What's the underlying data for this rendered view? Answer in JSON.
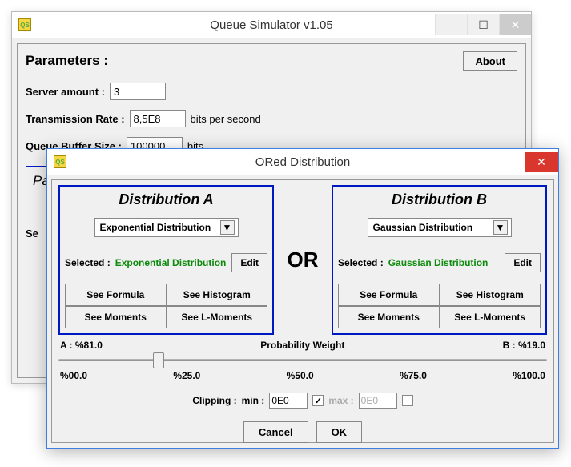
{
  "main": {
    "title": "Queue Simulator v1.05",
    "icon_text": "QS",
    "params_label": "Parameters :",
    "about_label": "About",
    "server_amount_label": "Server amount :",
    "server_amount_value": "3",
    "trans_rate_label": "Transmission Rate :",
    "trans_rate_value": "8,5E8",
    "trans_rate_unit": "bits per second",
    "queue_buf_label": "Queue Buffer Size :",
    "queue_buf_value": "100000",
    "queue_buf_unit": "bits",
    "partial_left": "Pa",
    "select_label": "Se"
  },
  "dialog": {
    "title": "ORed Distribution",
    "icon_text": "QS",
    "or_label": "OR",
    "distA": {
      "header": "Distribution A",
      "combo": "Exponential Distribution",
      "selected_label": "Selected :",
      "selected_value": "Exponential Distribution",
      "edit": "Edit",
      "see_formula": "See Formula",
      "see_histogram": "See Histogram",
      "see_moments": "See Moments",
      "see_lmoments": "See L-Moments"
    },
    "distB": {
      "header": "Distribution B",
      "combo": "Gaussian Distribution",
      "selected_label": "Selected :",
      "selected_value": "Gaussian Distribution",
      "edit": "Edit",
      "see_formula": "See Formula",
      "see_histogram": "See Histogram",
      "see_moments": "See Moments",
      "see_lmoments": "See L-Moments"
    },
    "slider": {
      "a_label": "A : %81.0",
      "center_label": "Probability Weight",
      "b_label": "B : %19.0",
      "t0": "%00.0",
      "t25": "%25.0",
      "t50": "%50.0",
      "t75": "%75.0",
      "t100": "%100.0"
    },
    "clip": {
      "label": "Clipping :",
      "min_label": "min :",
      "min_value": "0E0",
      "max_label": "max :",
      "max_value": "0E0"
    },
    "cancel": "Cancel",
    "ok": "OK"
  }
}
